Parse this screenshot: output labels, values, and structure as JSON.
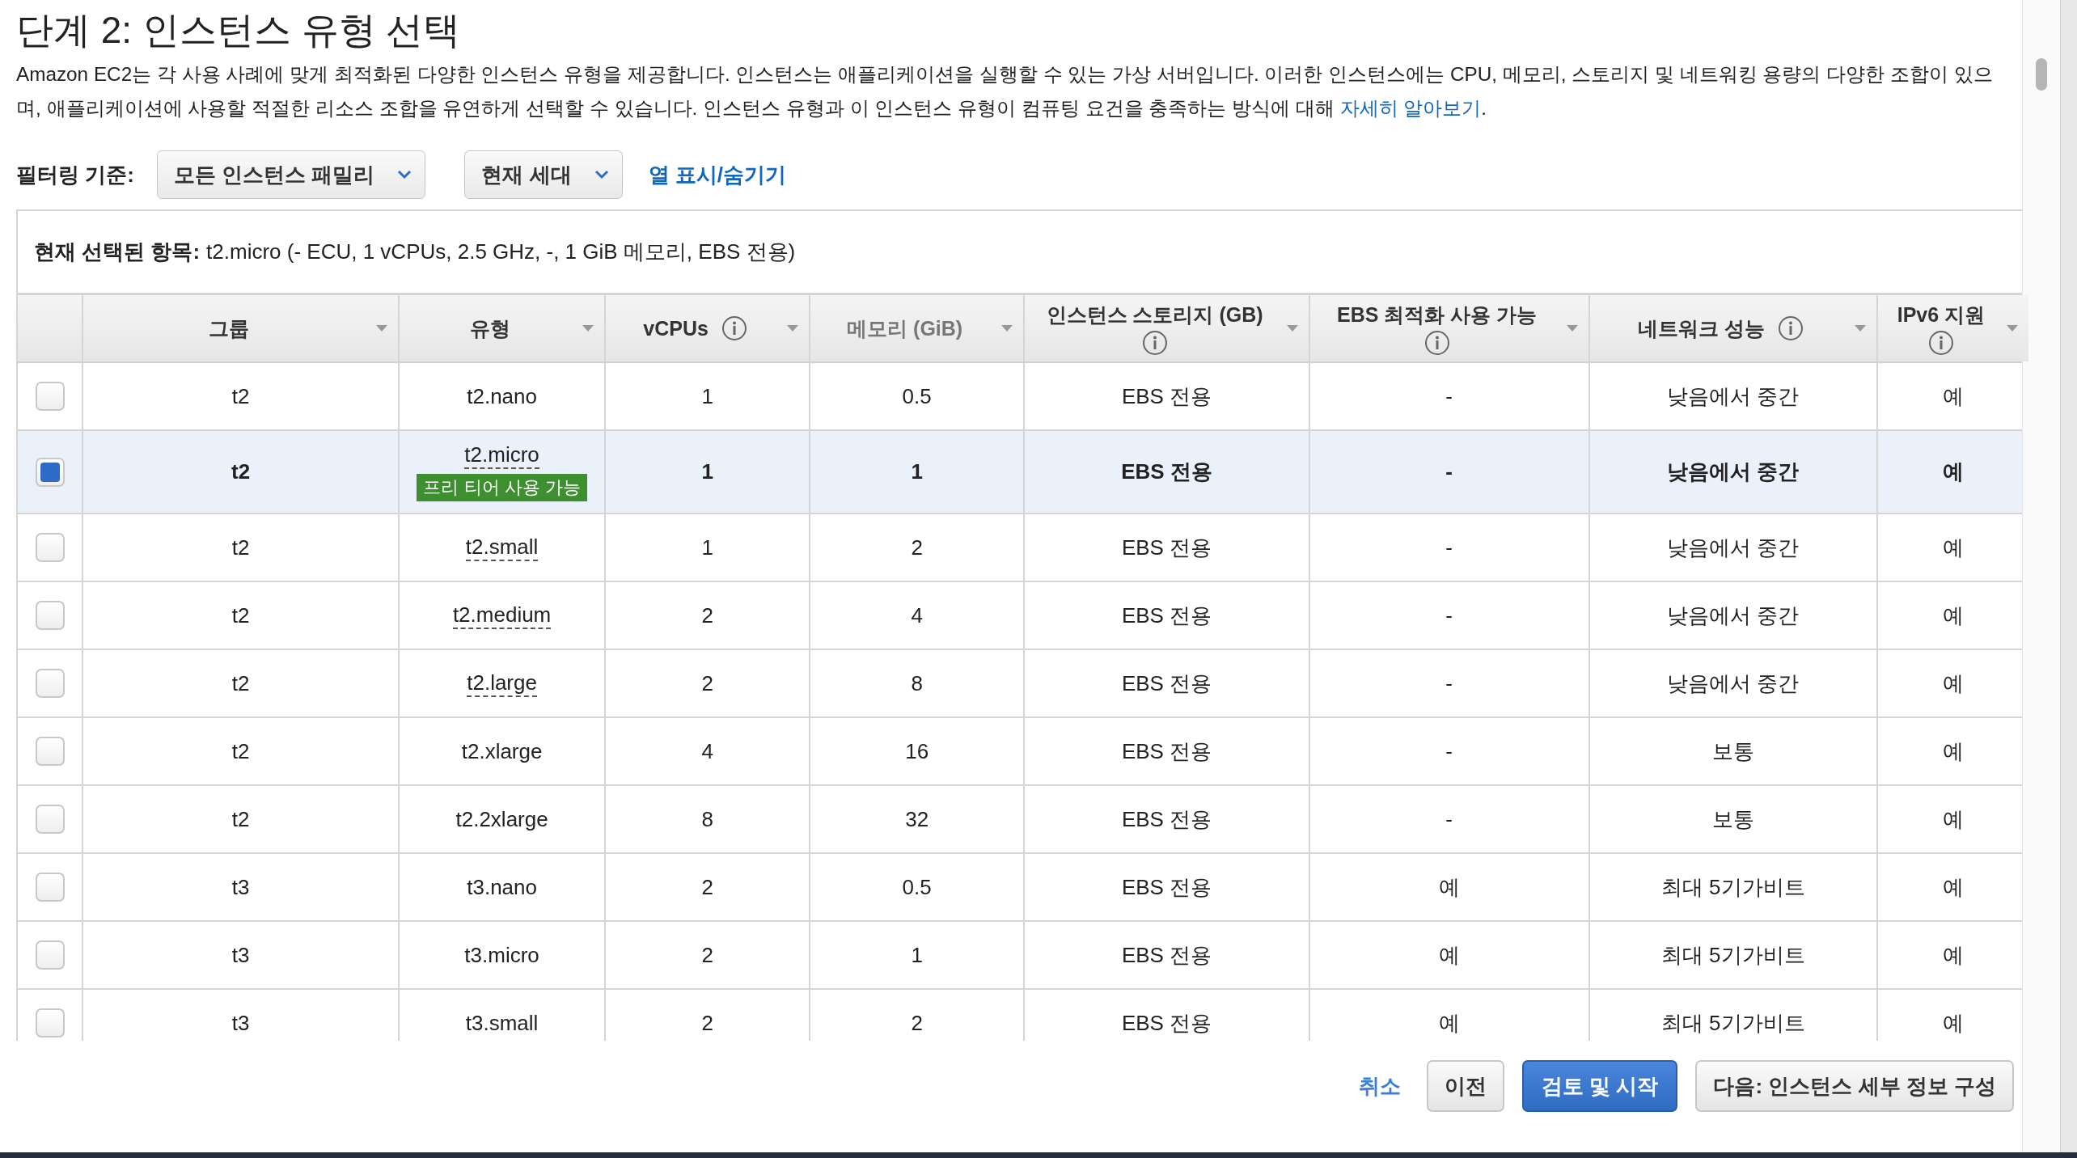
{
  "title": "단계 2: 인스턴스 유형 선택",
  "description": {
    "text": "Amazon EC2는 각 사용 사례에 맞게 최적화된 다양한 인스턴스 유형을 제공합니다. 인스턴스는 애플리케이션을 실행할 수 있는 가상 서버입니다. 이러한 인스턴스에는 CPU, 메모리, 스토리지 및 네트워킹 용량의 다양한 조합이 있으며, 애플리케이션에 사용할 적절한 리소스 조합을 유연하게 선택할 수 있습니다. 인스턴스 유형과 이 인스턴스 유형이 컴퓨팅 요건을 충족하는 방식에 대해",
    "link": "자세히 알아보기",
    "after": "."
  },
  "filter": {
    "label": "필터링 기준:",
    "family_dropdown": "모든 인스턴스 패밀리",
    "generation_dropdown": "현재 세대",
    "columns_link": "열 표시/숨기기"
  },
  "selection_summary": {
    "label": "현재 선택된 항목:",
    "value": "t2.micro (- ECU, 1 vCPUs, 2.5 GHz, -, 1 GiB 메모리, EBS 전용)"
  },
  "table": {
    "columns": [
      {
        "label": "그룹",
        "info": false,
        "muted": false
      },
      {
        "label": "유형",
        "info": false,
        "muted": false
      },
      {
        "label": "vCPUs",
        "info": true,
        "muted": false
      },
      {
        "label": "메모리 (GiB)",
        "info": false,
        "muted": true
      },
      {
        "label": "인스턴스 스토리지 (GB)",
        "info": true,
        "muted": false
      },
      {
        "label": "EBS 최적화 사용 가능",
        "info": true,
        "muted": false
      },
      {
        "label": "네트워크 성능",
        "info": true,
        "muted": false
      },
      {
        "label": "IPv6 지원",
        "info": true,
        "muted": false
      }
    ],
    "rows": [
      {
        "selected": false,
        "cells": [
          "t2",
          "t2.nano",
          "1",
          "0.5",
          "EBS 전용",
          "-",
          "낮음에서 중간",
          "예"
        ],
        "dotted": false
      },
      {
        "selected": true,
        "cells": [
          "t2",
          "t2.micro",
          "1",
          "1",
          "EBS 전용",
          "-",
          "낮음에서 중간",
          "예"
        ],
        "dotted": true,
        "badge": "프리 티어 사용 가능"
      },
      {
        "selected": false,
        "cells": [
          "t2",
          "t2.small",
          "1",
          "2",
          "EBS 전용",
          "-",
          "낮음에서 중간",
          "예"
        ],
        "dotted": true
      },
      {
        "selected": false,
        "cells": [
          "t2",
          "t2.medium",
          "2",
          "4",
          "EBS 전용",
          "-",
          "낮음에서 중간",
          "예"
        ],
        "dotted": true
      },
      {
        "selected": false,
        "cells": [
          "t2",
          "t2.large",
          "2",
          "8",
          "EBS 전용",
          "-",
          "낮음에서 중간",
          "예"
        ],
        "dotted": true
      },
      {
        "selected": false,
        "cells": [
          "t2",
          "t2.xlarge",
          "4",
          "16",
          "EBS 전용",
          "-",
          "보통",
          "예"
        ],
        "dotted": false
      },
      {
        "selected": false,
        "cells": [
          "t2",
          "t2.2xlarge",
          "8",
          "32",
          "EBS 전용",
          "-",
          "보통",
          "예"
        ],
        "dotted": false
      },
      {
        "selected": false,
        "cells": [
          "t3",
          "t3.nano",
          "2",
          "0.5",
          "EBS 전용",
          "예",
          "최대 5기가비트",
          "예"
        ],
        "dotted": false
      },
      {
        "selected": false,
        "cells": [
          "t3",
          "t3.micro",
          "2",
          "1",
          "EBS 전용",
          "예",
          "최대 5기가비트",
          "예"
        ],
        "dotted": false
      },
      {
        "selected": false,
        "cells": [
          "t3",
          "t3.small",
          "2",
          "2",
          "EBS 전용",
          "예",
          "최대 5기가비트",
          "예"
        ],
        "dotted": false
      }
    ]
  },
  "buttons": {
    "cancel": "취소",
    "previous": "이전",
    "review": "검토 및 시작",
    "next": "다음: 인스턴스 세부 정보 구성"
  }
}
